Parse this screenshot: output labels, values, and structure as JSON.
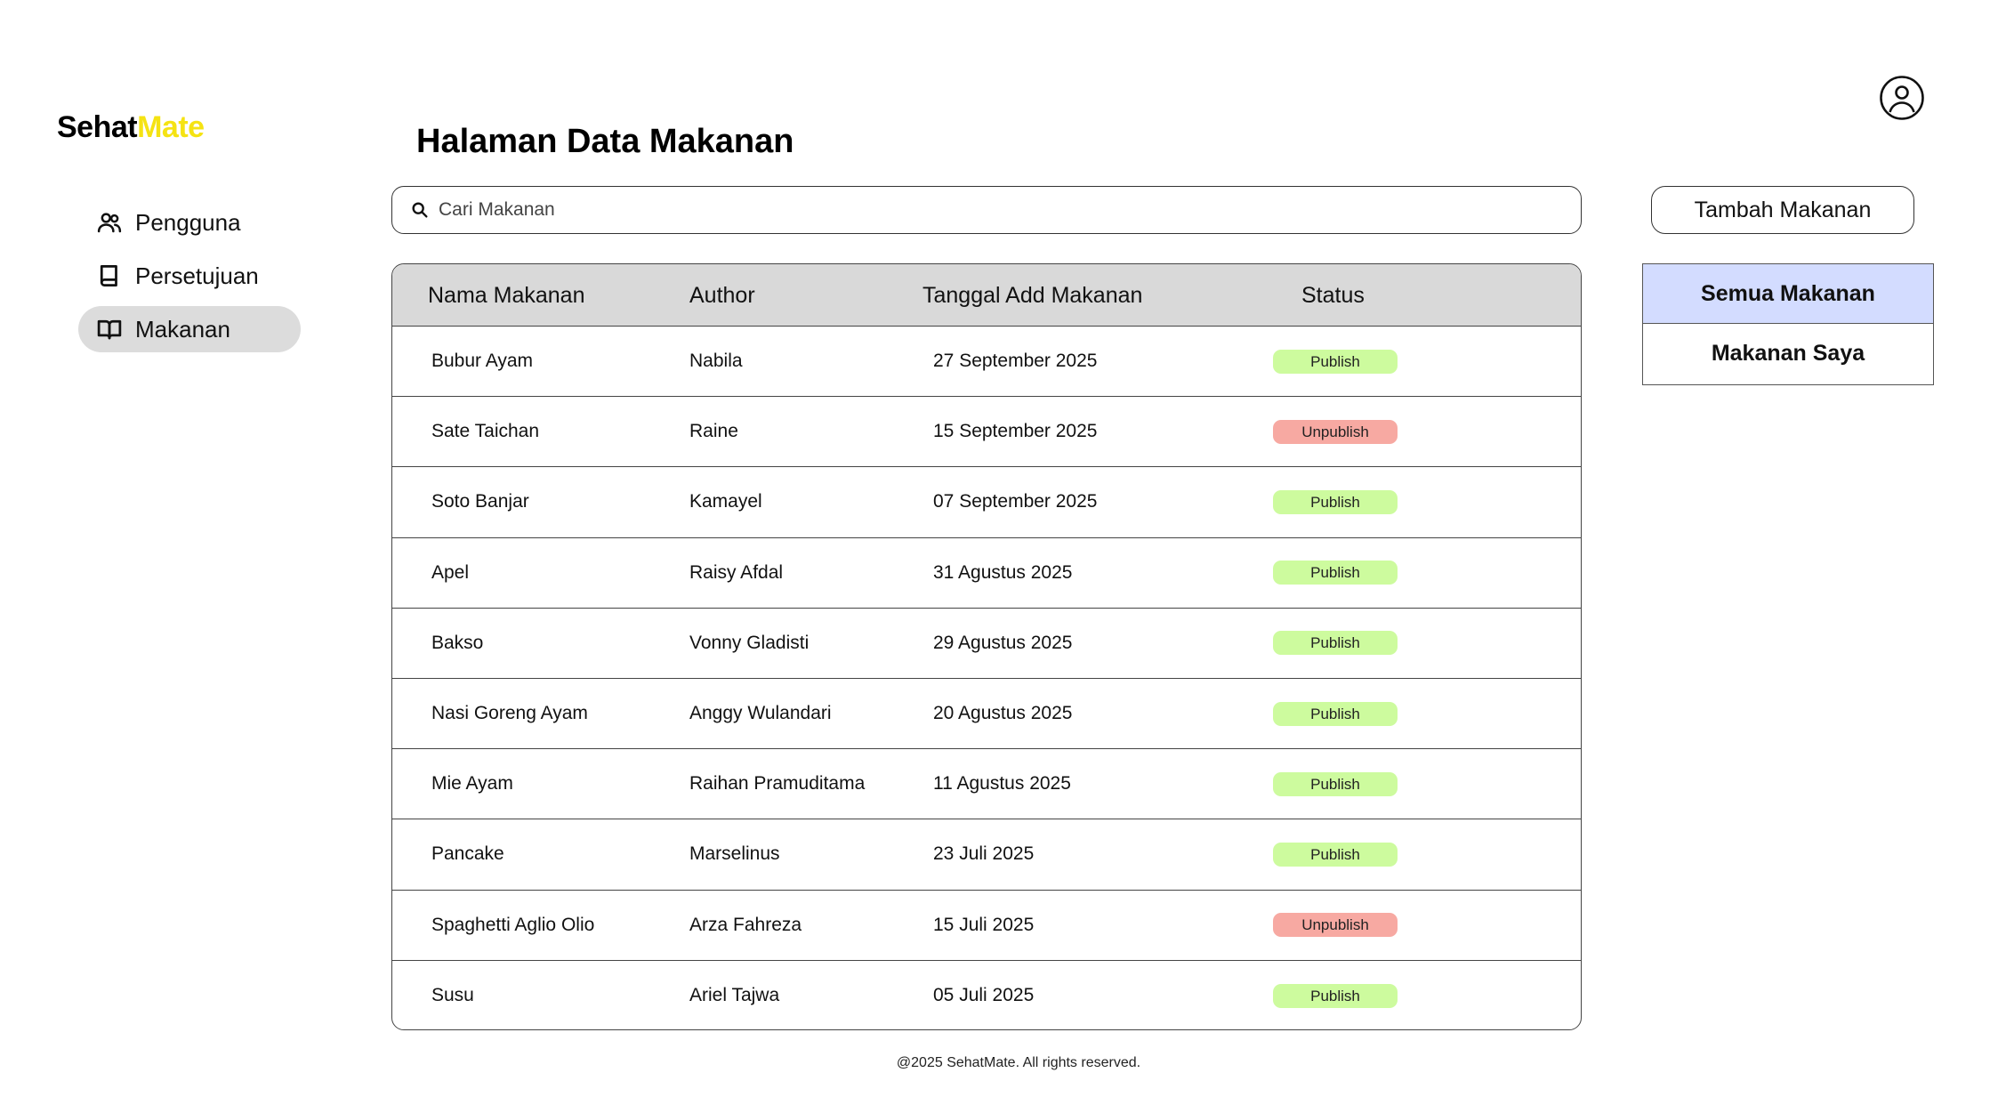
{
  "brand": {
    "part1": "Sehat",
    "part2": "Mate",
    "accent_color": "#f5e313"
  },
  "sidebar": {
    "items": [
      {
        "label": "Pengguna",
        "icon": "users-icon",
        "active": false
      },
      {
        "label": "Persetujuan",
        "icon": "book-icon",
        "active": false
      },
      {
        "label": "Makanan",
        "icon": "open-book-icon",
        "active": true
      }
    ]
  },
  "header": {
    "title": "Halaman Data Makanan",
    "avatar_icon": "user-circle-icon"
  },
  "search": {
    "placeholder": "Cari Makanan",
    "value": "",
    "icon": "search-icon"
  },
  "actions": {
    "add_label": "Tambah Makanan"
  },
  "filters": [
    {
      "label": "Semua Makanan",
      "active": true
    },
    {
      "label": "Makanan Saya",
      "active": false
    }
  ],
  "table": {
    "columns": [
      "Nama Makanan",
      "Author",
      "Tanggal Add Makanan",
      "Status"
    ],
    "rows": [
      {
        "name": "Bubur Ayam",
        "author": "Nabila",
        "date": "27 September 2025",
        "status": "Publish"
      },
      {
        "name": "Sate Taichan",
        "author": "Raine",
        "date": "15 September 2025",
        "status": "Unpublish"
      },
      {
        "name": "Soto Banjar",
        "author": "Kamayel",
        "date": "07 September 2025",
        "status": "Publish"
      },
      {
        "name": "Apel",
        "author": "Raisy Afdal",
        "date": "31 Agustus 2025",
        "status": "Publish"
      },
      {
        "name": "Bakso",
        "author": "Vonny Gladisti",
        "date": "29 Agustus 2025",
        "status": "Publish"
      },
      {
        "name": "Nasi Goreng Ayam",
        "author": "Anggy Wulandari",
        "date": "20 Agustus 2025",
        "status": "Publish"
      },
      {
        "name": "Mie Ayam",
        "author": "Raihan Pramuditama",
        "date": "11 Agustus 2025",
        "status": "Publish"
      },
      {
        "name": "Pancake",
        "author": "Marselinus",
        "date": "23 Juli 2025",
        "status": "Publish"
      },
      {
        "name": "Spaghetti Aglio Olio",
        "author": "Arza Fahreza",
        "date": "15 Juli 2025",
        "status": "Unpublish"
      },
      {
        "name": "Susu",
        "author": "Ariel Tajwa",
        "date": "05 Juli 2025",
        "status": "Publish"
      }
    ]
  },
  "status_colors": {
    "Publish": "#cdfb9e",
    "Unpublish": "#f7a9a2"
  },
  "footer": {
    "text": "@2025 SehatMate. All rights reserved."
  }
}
